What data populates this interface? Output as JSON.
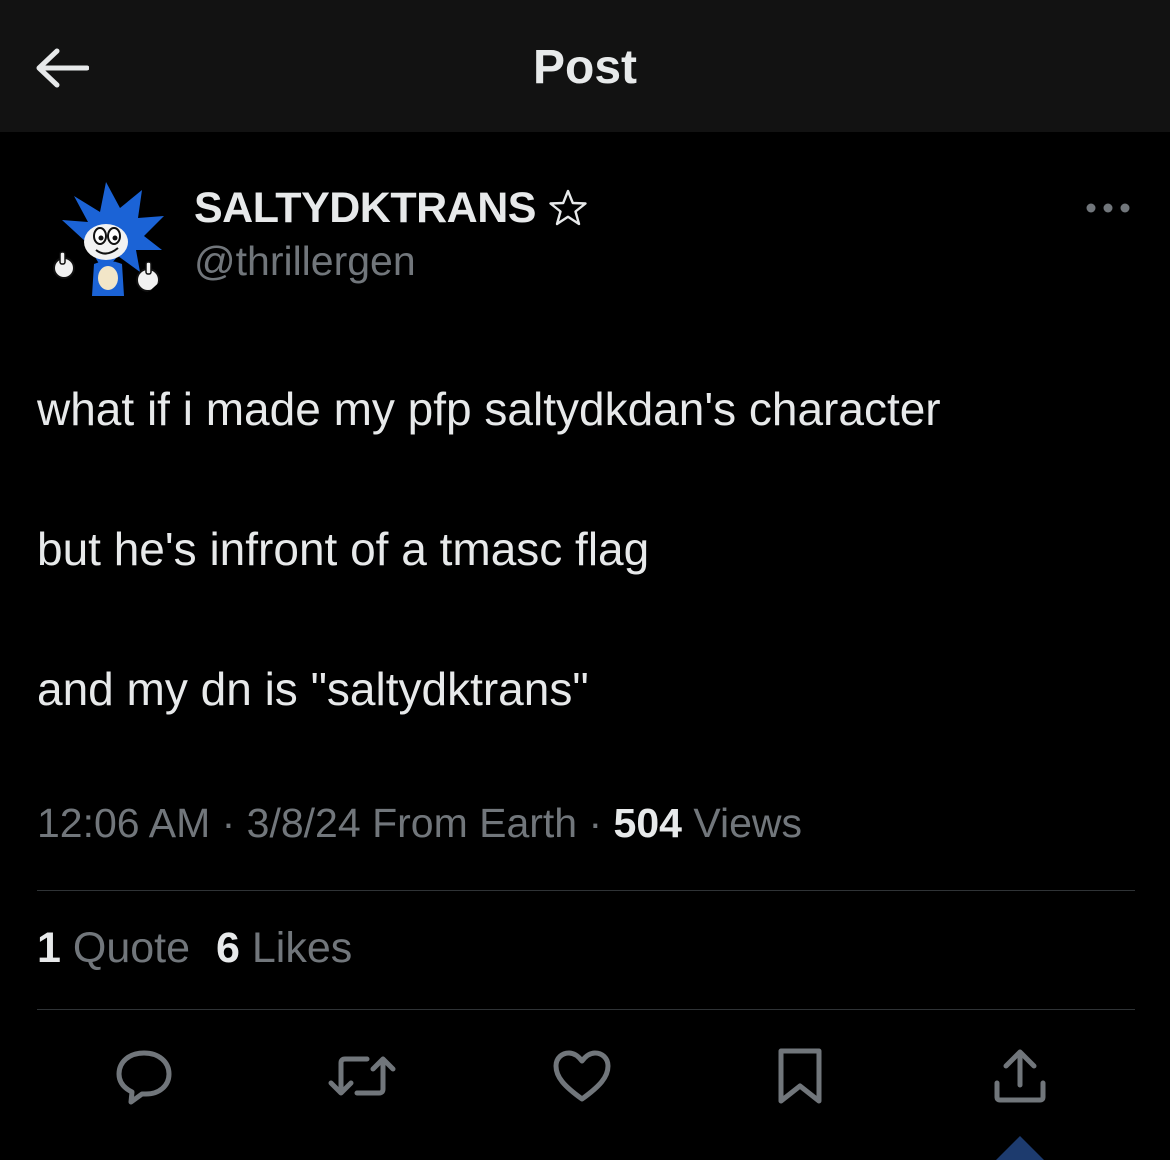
{
  "header": {
    "title": "Post",
    "back_icon": "arrow-left-icon"
  },
  "author": {
    "display_name": "SALTYDKTRANS",
    "handle": "@thrillergen",
    "name_icon": "star-outline-icon",
    "avatar": "sonic-style-character-avatar"
  },
  "post": {
    "lines": [
      "what if i made my pfp saltydkdan's character",
      "but he's infront of a tmasc flag",
      "and my dn is \"saltydktrans\""
    ]
  },
  "meta": {
    "time": "12:06 AM",
    "sep1": " · ",
    "date": "3/8/24",
    "location": " From Earth",
    "sep2": " · ",
    "views_count": "504",
    "views_label": " Views"
  },
  "stats": {
    "quotes_count": "1",
    "quotes_label": " Quote",
    "likes_count": "6",
    "likes_label": " Likes"
  },
  "actions": [
    "reply-icon",
    "repost-icon",
    "like-icon",
    "bookmark-icon",
    "share-icon"
  ],
  "colors": {
    "background": "#000000",
    "header_bg": "#121212",
    "primary_text": "#e7e9ea",
    "secondary_text": "#71767b",
    "divider": "#2f3336",
    "accent": "#1d3b6e"
  }
}
